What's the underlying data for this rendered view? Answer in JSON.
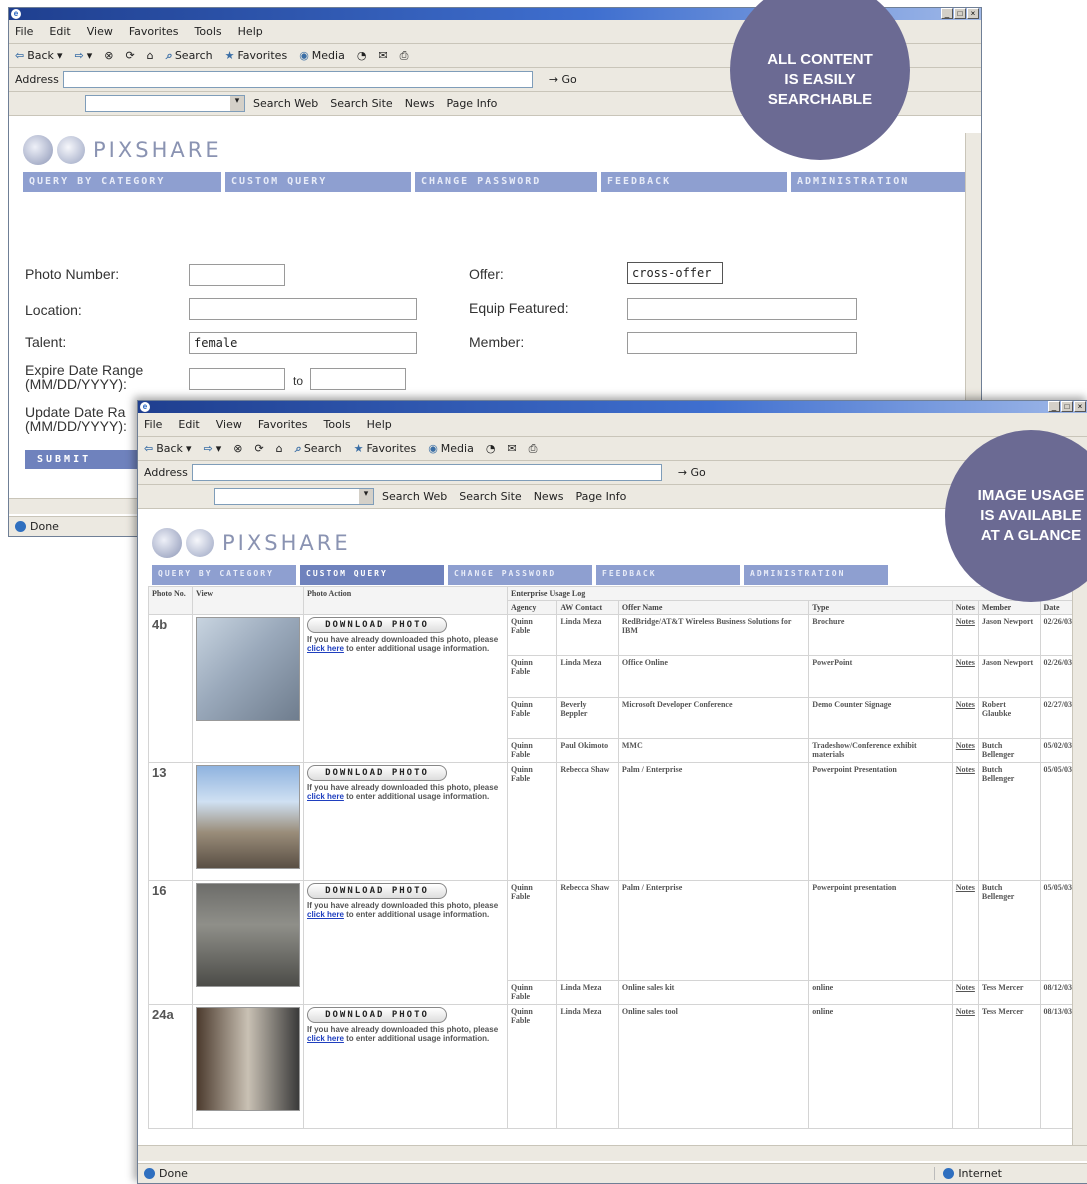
{
  "menu": [
    "File",
    "Edit",
    "View",
    "Favorites",
    "Tools",
    "Help"
  ],
  "toolbar": {
    "back": "Back",
    "search": "Search",
    "favorites": "Favorites",
    "media": "Media"
  },
  "address": {
    "label": "Address",
    "go": "Go"
  },
  "searchbar": {
    "web": "Search Web",
    "site": "Search Site",
    "news": "News",
    "info": "Page Info"
  },
  "logo": "PIXSHARE",
  "nav": [
    "QUERY BY CATEGORY",
    "CUSTOM QUERY",
    "CHANGE PASSWORD",
    "FEEDBACK",
    "ADMINISTRATION"
  ],
  "form": {
    "photo_number": "Photo Number:",
    "location": "Location:",
    "talent": "Talent:",
    "talent_value": "female",
    "expire_range": "Expire Date Range",
    "expire_fmt": "(MM/DD/YYYY):",
    "to": "to",
    "update_range": "Update Date Ra",
    "update_fmt": "(MM/DD/YYYY):",
    "offer": "Offer:",
    "offer_value": "cross-offer",
    "equip": "Equip Featured:",
    "member": "Member:",
    "submit": "SUBMIT"
  },
  "status": {
    "done": "Done",
    "zone": "Internet"
  },
  "table": {
    "h_photo": "Photo No.",
    "h_view": "View",
    "h_action": "Photo Action",
    "h_log": "Enterprise Usage Log",
    "cols": [
      "Agency",
      "AW Contact",
      "Offer Name",
      "Type",
      "Notes",
      "Member",
      "Date"
    ],
    "download": "DOWNLOAD PHOTO",
    "msg_pre": "If you have already downloaded this photo, please ",
    "msg_link": "click here",
    "msg_post": " to enter additional usage information.",
    "rows": [
      {
        "no": "4b",
        "log": [
          [
            "Quinn Fable",
            "Linda Meza",
            "RedBridge/AT&T Wireless Business Solutions for IBM",
            "Brochure",
            "Notes",
            "Jason Newport",
            "02/26/03"
          ],
          [
            "Quinn Fable",
            "Linda Meza",
            "Office Online",
            "PowerPoint",
            "Notes",
            "Jason Newport",
            "02/26/03"
          ],
          [
            "Quinn Fable",
            "Beverly Beppler",
            "Microsoft Developer Conference",
            "Demo Counter Signage",
            "Notes",
            "Robert Glaubke",
            "02/27/03"
          ],
          [
            "Quinn Fable",
            "Paul Okimoto",
            "MMC",
            "Tradeshow/Conference exhibit materials",
            "Notes",
            "Butch Bellenger",
            "05/02/03"
          ]
        ]
      },
      {
        "no": "13",
        "log": [
          [
            "Quinn Fable",
            "Rebecca Shaw",
            "Palm / Enterprise",
            "Powerpoint Presentation",
            "Notes",
            "Butch Bellenger",
            "05/05/03"
          ]
        ]
      },
      {
        "no": "16",
        "log": [
          [
            "Quinn Fable",
            "Rebecca Shaw",
            "Palm / Enterprise",
            "Powerpoint presentation",
            "Notes",
            "Butch Bellenger",
            "05/05/03"
          ],
          [
            "Quinn Fable",
            "Linda Meza",
            "Online sales kit",
            "online",
            "Notes",
            "Tess Mercer",
            "08/12/03"
          ]
        ]
      },
      {
        "no": "24a",
        "log": [
          [
            "Quinn Fable",
            "Linda Meza",
            "Online sales tool",
            "online",
            "Notes",
            "Tess Mercer",
            "08/13/03"
          ]
        ]
      }
    ]
  },
  "callouts": {
    "searchable": "ALL CONTENT IS EASILY SEARCHABLE",
    "usage": "IMAGE USAGE IS AVAILABLE AT A GLANCE"
  }
}
